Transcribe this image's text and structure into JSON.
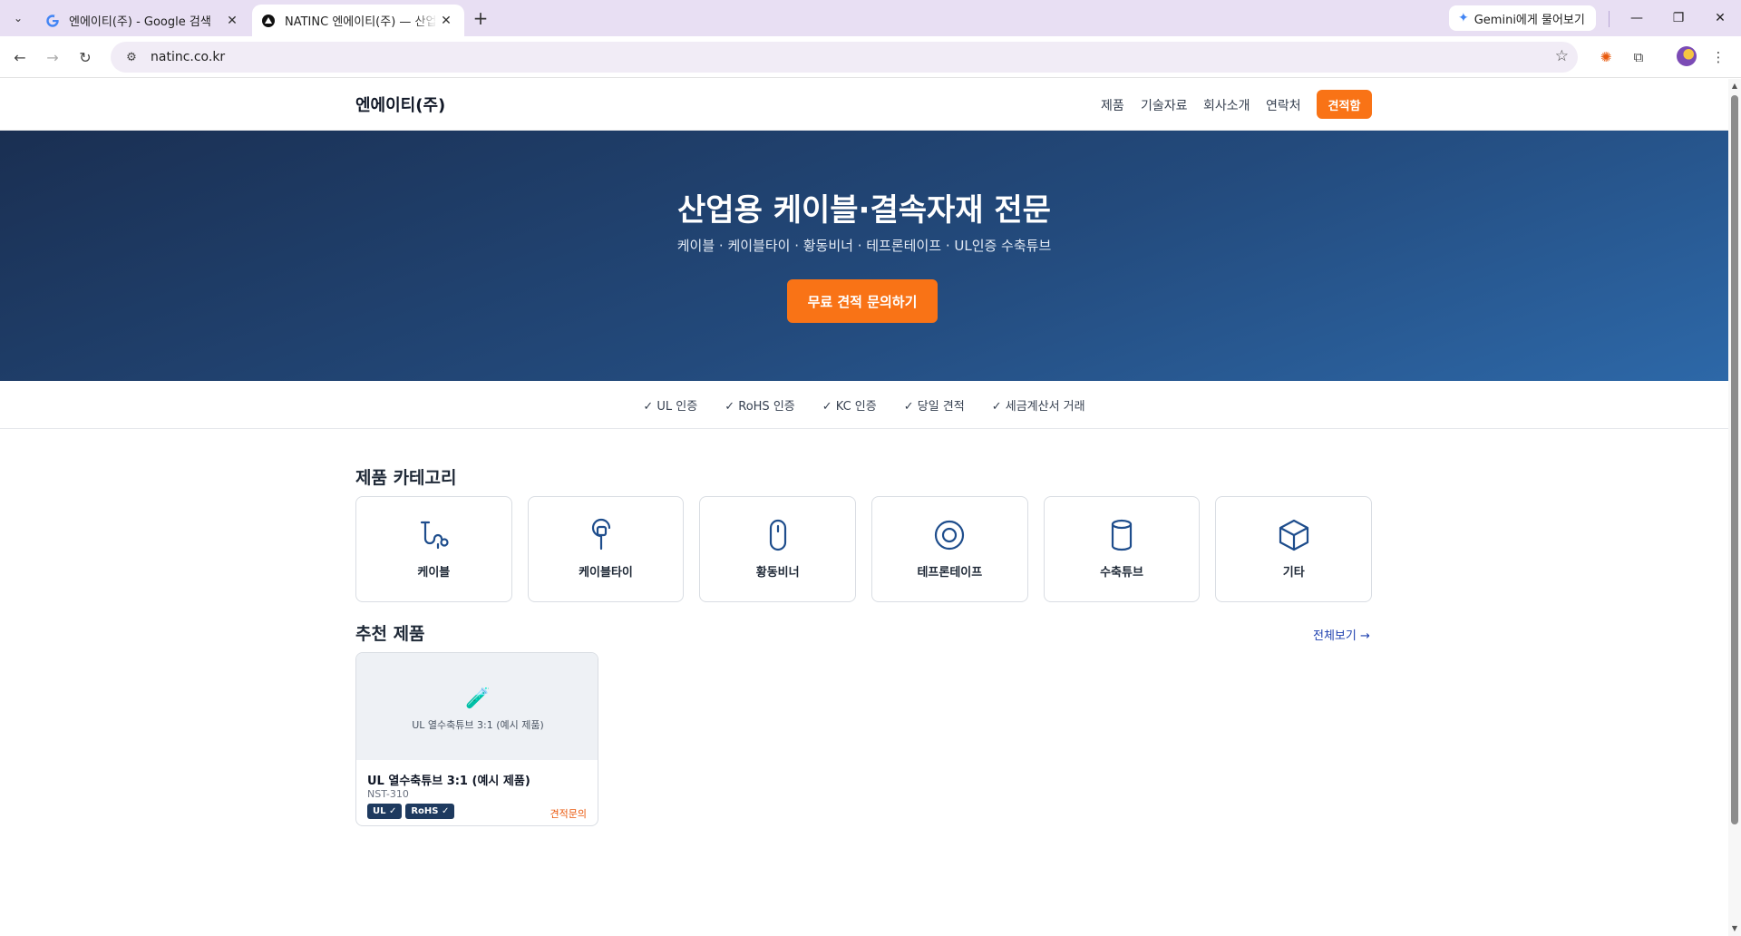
{
  "browser": {
    "tabs": [
      {
        "title": "엔에이티(주) - Google 검색",
        "favicon": "google-g-icon",
        "active": false
      },
      {
        "title": "NATINC 엔에이티(주) — 산업용",
        "favicon": "app-triangle-icon",
        "active": true
      }
    ],
    "new_tab_symbol": "+",
    "gemini_label": "Gemini에게 물어보기",
    "url": "natinc.co.kr"
  },
  "site": {
    "brand": "엔에이티(주)",
    "nav": [
      "제품",
      "기술자료",
      "회사소개",
      "연락처"
    ],
    "quote_button": "견적함",
    "hero": {
      "title": "산업용 케이블·결속자재 전문",
      "subtitle": "케이블 · 케이블타이 · 황동비너 · 테프론테이프 · UL인증 수축튜브",
      "cta": "무료 견적 문의하기"
    },
    "trust": [
      "✓ UL 인증",
      "✓ RoHS 인증",
      "✓ KC 인증",
      "✓ 당일 견적",
      "✓ 세금계산서 거래"
    ],
    "categories_title": "제품 카테고리",
    "categories": [
      {
        "label": "케이블",
        "icon": "cable-icon"
      },
      {
        "label": "케이블타이",
        "icon": "cable-tie-icon"
      },
      {
        "label": "황동비너",
        "icon": "mouse-icon"
      },
      {
        "label": "테프론테이프",
        "icon": "tape-roll-icon"
      },
      {
        "label": "수축튜브",
        "icon": "cylinder-icon"
      },
      {
        "label": "기타",
        "icon": "box-icon"
      }
    ],
    "featured_title": "추천 제품",
    "see_all": "전체보기 →",
    "products": [
      {
        "image_emoji": "🧪",
        "image_caption": "UL 열수축튜브 3:1 (예시 제품)",
        "name": "UL 열수축튜브 3:1 (예시 제품)",
        "code": "NST-310",
        "badges": [
          "UL ✓",
          "RoHS ✓"
        ],
        "action": "견적문의"
      }
    ]
  },
  "colors": {
    "accent": "#f97316",
    "hero_start": "#1a2f52",
    "hero_end": "#2d68a8",
    "badge": "#1e3a5f",
    "chrome_tabstrip": "#e8dff3"
  }
}
